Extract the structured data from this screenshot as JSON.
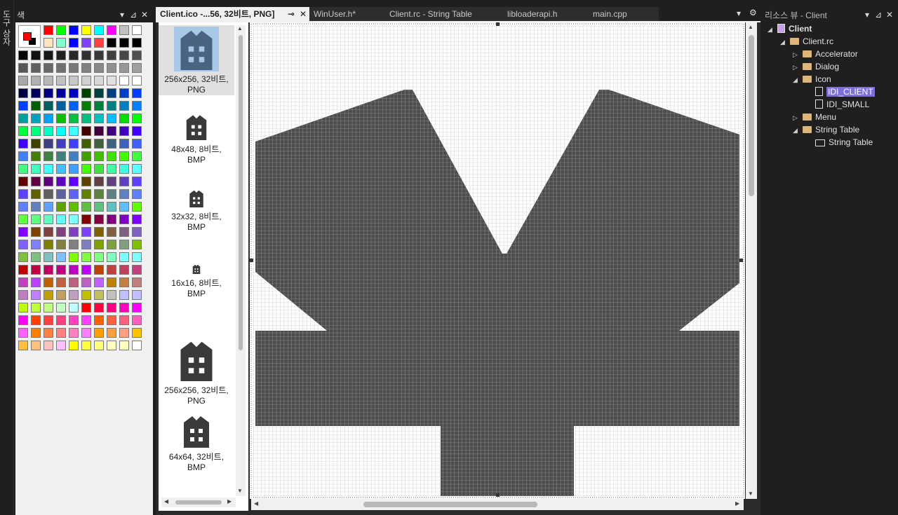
{
  "side_strip": {
    "label": "도구 상자"
  },
  "color_panel": {
    "title": "색",
    "pin": "⊿",
    "close": "✕"
  },
  "tabs": [
    {
      "label": "Client.ico -...56, 32비트, PNG]",
      "active": true,
      "pin": "⊸",
      "close": "✕"
    },
    {
      "label": "WinUser.h*",
      "active": false
    },
    {
      "label": "Client.rc - String Table",
      "active": false
    },
    {
      "label": "libloaderapi.h",
      "active": false
    },
    {
      "label": "main.cpp",
      "active": false
    }
  ],
  "tab_overflow": "▾",
  "tab_settings": "⚙",
  "image_types": [
    {
      "line1": "256x256, 32비트,",
      "line2": "PNG",
      "selected": true
    },
    {
      "line1": "48x48, 8비트,",
      "line2": "BMP",
      "selected": false
    },
    {
      "line1": "32x32, 8비트,",
      "line2": "BMP",
      "selected": false
    },
    {
      "line1": "16x16, 8비트,",
      "line2": "BMP",
      "selected": false
    },
    {
      "line1": "256x256, 32비트,",
      "line2": "PNG",
      "selected": false
    },
    {
      "line1": "64x64, 32비트,",
      "line2": "BMP",
      "selected": false
    }
  ],
  "resource_view": {
    "title": "리소스 뷰 - Client",
    "tree": [
      {
        "label": "Client",
        "level": 0,
        "arrow": "◢",
        "type": "root",
        "bold": true
      },
      {
        "label": "Client.rc",
        "level": 1,
        "arrow": "◢",
        "type": "folder"
      },
      {
        "label": "Accelerator",
        "level": 2,
        "arrow": "▷",
        "type": "folder"
      },
      {
        "label": "Dialog",
        "level": 2,
        "arrow": "▷",
        "type": "folder"
      },
      {
        "label": "Icon",
        "level": 2,
        "arrow": "◢",
        "type": "folder"
      },
      {
        "label": "IDI_CLIENT",
        "level": 3,
        "arrow": "",
        "type": "file",
        "selected": true
      },
      {
        "label": "IDI_SMALL",
        "level": 3,
        "arrow": "",
        "type": "file"
      },
      {
        "label": "Menu",
        "level": 2,
        "arrow": "▷",
        "type": "folder"
      },
      {
        "label": "String Table",
        "level": 2,
        "arrow": "◢",
        "type": "folder"
      },
      {
        "label": "String Table",
        "level": 3,
        "arrow": "",
        "type": "table"
      }
    ]
  },
  "colors": {
    "foreground": "#ff0000",
    "background": "#000000",
    "top_row": [
      "#ff0000",
      "#00ff00",
      "#0000ff",
      "#ffff00",
      "#00ffff",
      "#ff00ff",
      "#c0c0c0",
      "#ffffff"
    ],
    "second_row": [
      "#ffe4c4",
      "#80ffcc",
      "#0000ff",
      "#8040ff",
      "#ff4040",
      "#000000",
      "#000000",
      "#000000"
    ],
    "rows": [
      [
        "#000000",
        "#101010",
        "#181818",
        "#202020",
        "#282828",
        "#303030",
        "#383838",
        "#404040",
        "#484848",
        "#505050"
      ],
      [
        "#585858",
        "#606060",
        "#686868",
        "#707070",
        "#787878",
        "#808080",
        "#888888",
        "#909090",
        "#989898",
        "#a0a0a0"
      ],
      [
        "#a8a8a8",
        "#b0b0b0",
        "#b8b8b8",
        "#c0c0c0",
        "#c8c8c8",
        "#d0d0d0",
        "#d8d8d8",
        "#e0e0e0",
        "#ffffff",
        "#ffffff"
      ],
      [
        "#000040",
        "#000060",
        "#000080",
        "#0000a0",
        "#0000c0",
        "#004000",
        "#004040",
        "#004080",
        "#0040c0",
        "#0040ff"
      ],
      [
        "#0040ff",
        "#006000",
        "#006060",
        "#0060a0",
        "#0060ff",
        "#008000",
        "#008040",
        "#008080",
        "#0080c0",
        "#0080ff"
      ],
      [
        "#00a0a0",
        "#00a0c0",
        "#00a0ff",
        "#00c000",
        "#00c040",
        "#00c080",
        "#00c0c0",
        "#00c0ff",
        "#00e000",
        "#00ff00"
      ],
      [
        "#00ff40",
        "#00ff80",
        "#00ffc0",
        "#00ffff",
        "#40ffff",
        "#400000",
        "#400040",
        "#400080",
        "#4000c0",
        "#4000ff"
      ],
      [
        "#4000ff",
        "#404000",
        "#404080",
        "#4040c0",
        "#4040ff",
        "#406000",
        "#406040",
        "#406080",
        "#4060c0",
        "#4060ff"
      ],
      [
        "#4080ff",
        "#408000",
        "#408040",
        "#408080",
        "#4080c0",
        "#40a000",
        "#40c000",
        "#40e000",
        "#40ff00",
        "#40ff40"
      ],
      [
        "#40ff80",
        "#40ffc0",
        "#40ffff",
        "#40c0ff",
        "#40a0ff",
        "#40ff00",
        "#40e040",
        "#40ffa0",
        "#40ffe0",
        "#60ffff"
      ],
      [
        "#600000",
        "#600040",
        "#600080",
        "#6000c0",
        "#6000ff",
        "#604000",
        "#604040",
        "#604080",
        "#6040c0",
        "#6040ff"
      ],
      [
        "#6040ff",
        "#606000",
        "#606060",
        "#6060a0",
        "#6060ff",
        "#608000",
        "#608040",
        "#608080",
        "#6080c0",
        "#6080ff"
      ],
      [
        "#6080ff",
        "#6080c0",
        "#60a0ff",
        "#60a000",
        "#60c000",
        "#60c040",
        "#60c080",
        "#60c0c0",
        "#60c0ff",
        "#60ff00"
      ],
      [
        "#60ff40",
        "#60ff80",
        "#60ffc0",
        "#60ffff",
        "#80ffff",
        "#800000",
        "#800040",
        "#800080",
        "#8000c0",
        "#8000ff"
      ],
      [
        "#8000ff",
        "#804000",
        "#804040",
        "#804080",
        "#8040c0",
        "#8040ff",
        "#806000",
        "#806040",
        "#806080",
        "#8060c0"
      ],
      [
        "#8060ff",
        "#8080ff",
        "#808000",
        "#808040",
        "#808080",
        "#8080c0",
        "#80a000",
        "#80a040",
        "#80a080",
        "#80c000"
      ],
      [
        "#80c040",
        "#80c080",
        "#80c0c0",
        "#80c0ff",
        "#80ff00",
        "#80ff40",
        "#80ff80",
        "#80ffc0",
        "#80ffff",
        "#80ffff"
      ],
      [
        "#c00000",
        "#c00040",
        "#c00060",
        "#c00080",
        "#c000c0",
        "#c000ff",
        "#c04000",
        "#c04040",
        "#c04060",
        "#c04080"
      ],
      [
        "#c040c0",
        "#c040ff",
        "#c06000",
        "#c06040",
        "#c06080",
        "#c060c0",
        "#c060ff",
        "#c08000",
        "#c08040",
        "#c08080"
      ],
      [
        "#c080c0",
        "#c080ff",
        "#c0a000",
        "#c0a060",
        "#c0a0c0",
        "#c0c000",
        "#c0c060",
        "#c0c0c0",
        "#c0c0ff",
        "#c0c0ff"
      ],
      [
        "#c0ff00",
        "#c0ff40",
        "#c0ff80",
        "#c0ffc0",
        "#c0ffff",
        "#ff0000",
        "#ff0040",
        "#ff0080",
        "#ff00c0",
        "#ff00ff"
      ],
      [
        "#ff00ff",
        "#ff4000",
        "#ff4040",
        "#ff4080",
        "#ff40c0",
        "#ff40ff",
        "#ff6000",
        "#ff6040",
        "#ff6080",
        "#ff60c0"
      ],
      [
        "#ff60ff",
        "#ff8000",
        "#ff8040",
        "#ff8080",
        "#ff80c0",
        "#ff80ff",
        "#ffa000",
        "#ffa040",
        "#ffa080",
        "#ffc000"
      ],
      [
        "#ffc040",
        "#ffc080",
        "#ffc0c0",
        "#ffc0ff",
        "#ffff00",
        "#ffff40",
        "#ffff80",
        "#ffffc0",
        "#ffffc0",
        "#ffffff"
      ]
    ]
  }
}
